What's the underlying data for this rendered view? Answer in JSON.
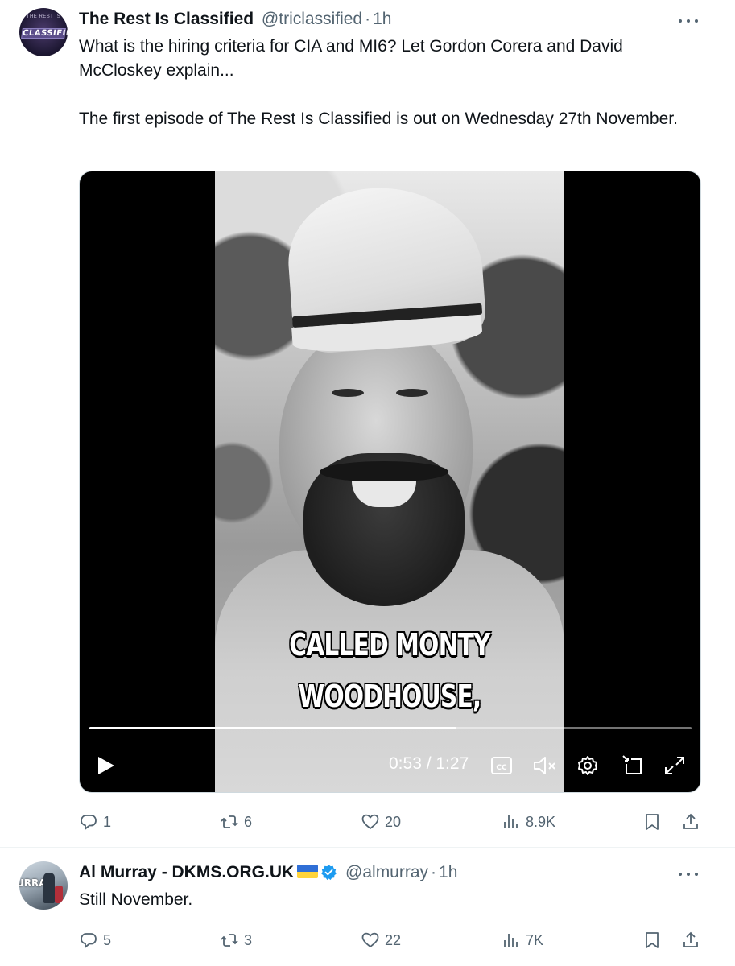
{
  "top_fragment": "/, , ...",
  "tweets": [
    {
      "author": {
        "name": "The Rest Is Classified",
        "handle": "@triclassified",
        "time": "1h",
        "avatar": {
          "top_text": "THE REST IS",
          "main_text": "CLASSIFIED"
        }
      },
      "text": {
        "p1": "What is the hiring criteria for CIA and MI6? Let Gordon Corera and David McCloskey explain...",
        "p2": "The first episode of The Rest Is Classified is out on Wednesday 27th November."
      },
      "video": {
        "caption_line1": "CALLED MONTY",
        "caption_line2": "WOODHOUSE,",
        "timecode": "0:53 / 1:27",
        "progress": 0.61
      },
      "actions": {
        "replies": "1",
        "reposts": "6",
        "likes": "20",
        "views": "8.9K"
      }
    },
    {
      "author": {
        "name": "Al Murray - DKMS.ORG.UK",
        "handle": "@almurray",
        "time": "1h",
        "avatar": {
          "main_text": "URRAY"
        }
      },
      "text": {
        "p1": "Still November."
      },
      "actions": {
        "replies": "5",
        "reposts": "3",
        "likes": "22",
        "views": "7K"
      }
    }
  ],
  "icons": {
    "more": "more-horizontal-icon",
    "reply": "reply-bubble-icon",
    "repost": "repost-icon",
    "like": "heart-icon",
    "views": "analytics-bars-icon",
    "bookmark": "bookmark-icon",
    "share": "share-upload-icon",
    "verified": "verified-badge-icon",
    "flag": "ukraine-flag-icon"
  },
  "colors": {
    "text": "#0f1419",
    "secondary": "#536471",
    "verified": "#1d9bf0",
    "divider": "#eff3f4"
  }
}
